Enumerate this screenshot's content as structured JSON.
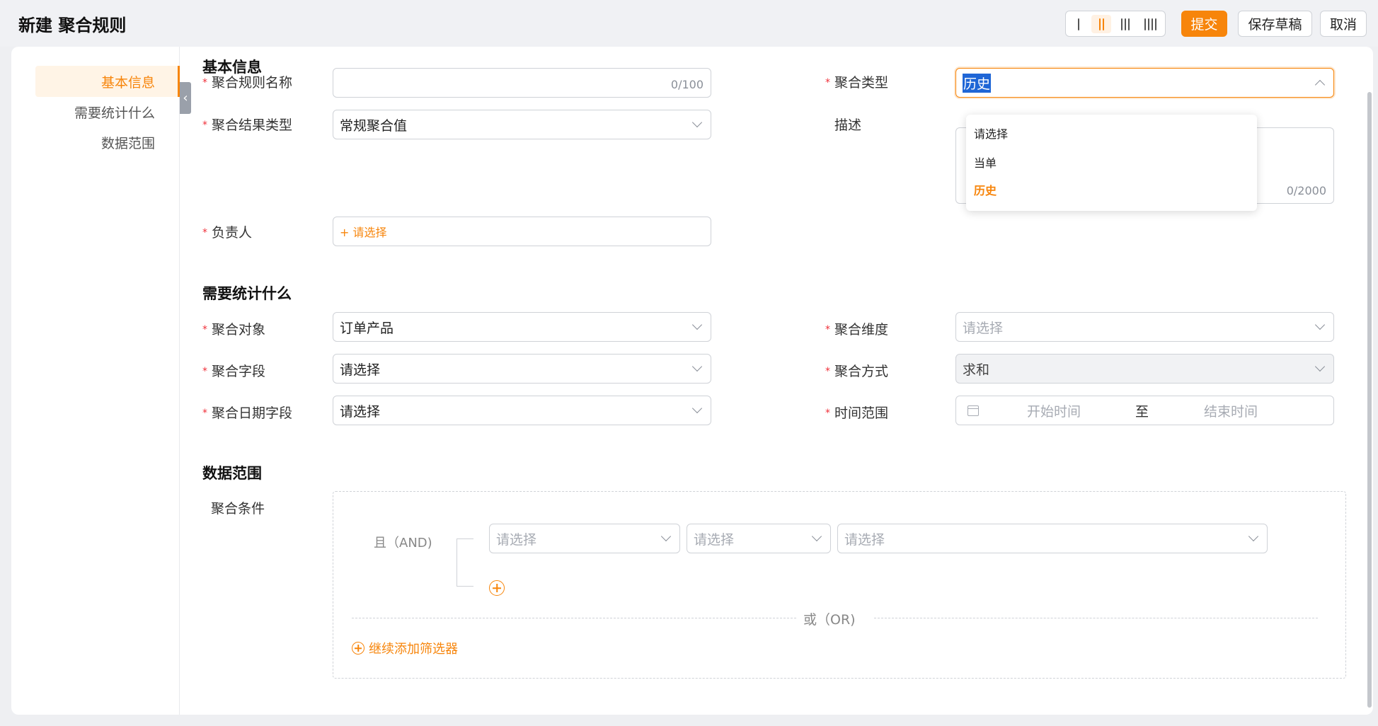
{
  "header": {
    "title": "新建 聚合规则",
    "submit": "提交",
    "save_draft": "保存草稿",
    "cancel": "取消"
  },
  "nav": {
    "items": [
      "基本信息",
      "需要统计什么",
      "数据范围"
    ],
    "active": "基本信息"
  },
  "sections": {
    "basic": "基本信息",
    "stat": "需要统计什么",
    "scope": "数据范围"
  },
  "basic": {
    "name_label": "聚合规则名称",
    "name_value": "",
    "name_counter": "0/100",
    "type_label": "聚合类型",
    "type_value": "历史",
    "result_type_label": "聚合结果类型",
    "result_type_value": "常规聚合值",
    "desc_label": "描述",
    "desc_counter": "0/2000",
    "owner_label": "负责人",
    "owner_placeholder": "+ 请选择"
  },
  "type_dropdown": {
    "options": [
      "请选择",
      "当单",
      "历史"
    ],
    "selected": "历史"
  },
  "stat": {
    "object_label": "聚合对象",
    "object_value": "订单产品",
    "dimension_label": "聚合维度",
    "dimension_placeholder": "请选择",
    "field_label": "聚合字段",
    "field_value": "请选择",
    "method_label": "聚合方式",
    "method_value": "求和",
    "date_field_label": "聚合日期字段",
    "date_field_value": "请选择",
    "time_range_label": "时间范围",
    "start_placeholder": "开始时间",
    "range_sep": "至",
    "end_placeholder": "结束时间"
  },
  "scope": {
    "condition_label": "聚合条件",
    "and_label": "且（AND)",
    "cond_placeholder_1": "请选择",
    "cond_placeholder_2": "请选择",
    "cond_placeholder_3": "请选择",
    "or_label": "或（OR)",
    "add_filter": "继续添加筛选器"
  },
  "colors": {
    "accent": "#f7850b",
    "required": "#f0303a"
  }
}
